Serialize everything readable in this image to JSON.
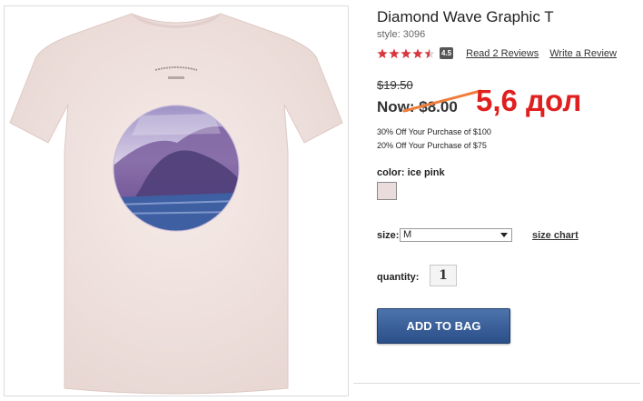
{
  "product": {
    "title": "Diamond Wave Graphic T",
    "style": "style: 3096",
    "rating": {
      "value": 4.5,
      "badge": "4.5",
      "reviews_link": "Read 2 Reviews",
      "write_link": "Write a Review",
      "star_color": "#d9363e"
    },
    "brand_text": "AEROPOSTALE",
    "size_tag": "S/P"
  },
  "pricing": {
    "was": "$19.50",
    "now": "Now: $8.00",
    "annotation": "5,6 дол",
    "annotation_color": "#e01f1f",
    "strike_color": "#f07c3a"
  },
  "promos": [
    "30% Off Your Purchase of $100",
    "20% Off Your Purchase of $75"
  ],
  "color": {
    "label": "color:",
    "value": "ice pink",
    "swatch": "#eadcdc"
  },
  "size": {
    "label": "size:",
    "selected": "M",
    "chart_link": "size chart"
  },
  "quantity": {
    "label": "quantity:",
    "value": "1"
  },
  "cart": {
    "button_label": "ADD TO BAG",
    "button_color": "#2f5590"
  }
}
